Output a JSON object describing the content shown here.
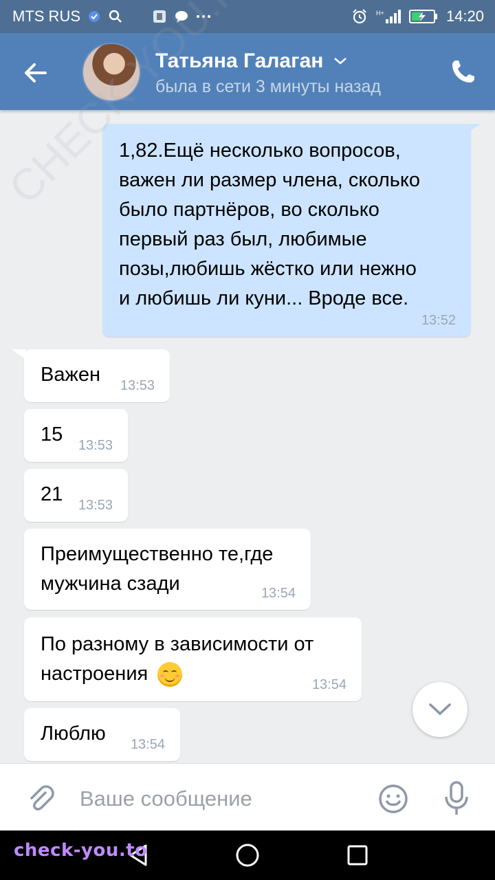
{
  "status_bar": {
    "carrier": "MTS RUS",
    "network_type": "H+",
    "time": "14:20",
    "icons": [
      "nfc-icon",
      "search-icon",
      "app-icon",
      "chat-bubble-icon",
      "more-icon",
      "alarm-icon",
      "signal-icon",
      "battery-icon"
    ]
  },
  "header": {
    "contact_name": "Татьяна Галаган",
    "contact_status": "была в сети 3 минуты назад",
    "colors": {
      "bar": "#5181b8",
      "status_bar": "#4e6f93"
    }
  },
  "messages": [
    {
      "dir": "out",
      "text": "1,82.Ещё несколько вопросов,\nважен ли размер члена, сколько\nбыло партнёров, во сколько\nпервый раз был, любимые\nпозы,любишь жёстко или нежно\nи любишь ли куни... Вроде все.",
      "time": "13:52"
    },
    {
      "dir": "in",
      "text": "Важен",
      "time": "13:53"
    },
    {
      "dir": "in",
      "text": "15",
      "time": "13:53"
    },
    {
      "dir": "in",
      "text": "21",
      "time": "13:53"
    },
    {
      "dir": "in",
      "text": "Преимущественно те,где\nмужчина сзади",
      "time": "13:54"
    },
    {
      "dir": "in",
      "text": "По разному в зависимости от\nнастроения",
      "emoji": "smiling-face-icon",
      "time": "13:54"
    },
    {
      "dir": "in",
      "text": "Люблю",
      "time": "13:54"
    }
  ],
  "input": {
    "placeholder": "Ваше сообщение"
  },
  "watermarks": {
    "overlay": "CHECK-YOU.ME",
    "bottom": "check-you.to"
  }
}
